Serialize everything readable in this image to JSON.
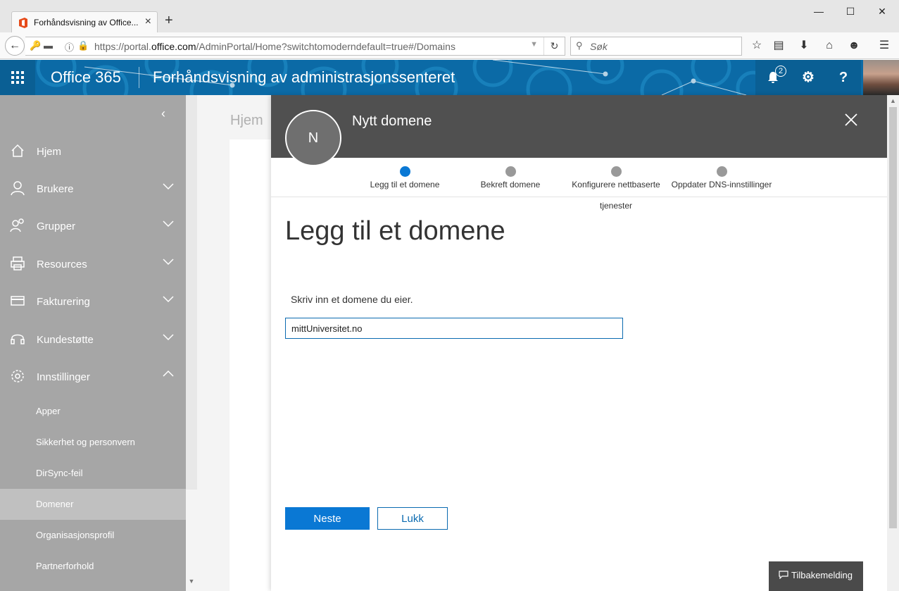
{
  "browser": {
    "tab_title": "Forhåndsvisning av Office...",
    "url_prefix": "https://portal.",
    "url_domain": "office.com",
    "url_path": "/AdminPortal/Home?switchtomoderndefault=true#/Domains",
    "search_placeholder": "Søk"
  },
  "header": {
    "brand": "Office 365",
    "title": "Forhåndsvisning av administrasjonssenteret",
    "notification_count": "2",
    "help_label": "?"
  },
  "sidebar": {
    "items": [
      {
        "label": "Hjem"
      },
      {
        "label": "Brukere"
      },
      {
        "label": "Grupper"
      },
      {
        "label": "Resources"
      },
      {
        "label": "Fakturering"
      },
      {
        "label": "Kundestøtte"
      },
      {
        "label": "Innstillinger"
      }
    ],
    "subitems": [
      {
        "label": "Apper"
      },
      {
        "label": "Sikkerhet og personvern"
      },
      {
        "label": "DirSync-feil"
      },
      {
        "label": "Domener"
      },
      {
        "label": "Organisasjonsprofil"
      },
      {
        "label": "Partnerforhold"
      }
    ]
  },
  "page": {
    "breadcrumb": "Hjem"
  },
  "panel": {
    "avatar_letter": "N",
    "title": "Nytt domene",
    "steps": [
      {
        "label": "Legg til et domene"
      },
      {
        "label": "Bekreft domene"
      },
      {
        "label": "Konfigurere nettbaserte"
      },
      {
        "label": "Oppdater DNS-innstillinger"
      }
    ],
    "step3_line2": "tjenester",
    "heading": "Legg til et domene",
    "prompt": "Skriv inn et domene du eier.",
    "domain_value": "mittUniversitet.no",
    "next_label": "Neste",
    "close_label": "Lukk"
  },
  "feedback": {
    "label": "Tilbakemelding"
  }
}
